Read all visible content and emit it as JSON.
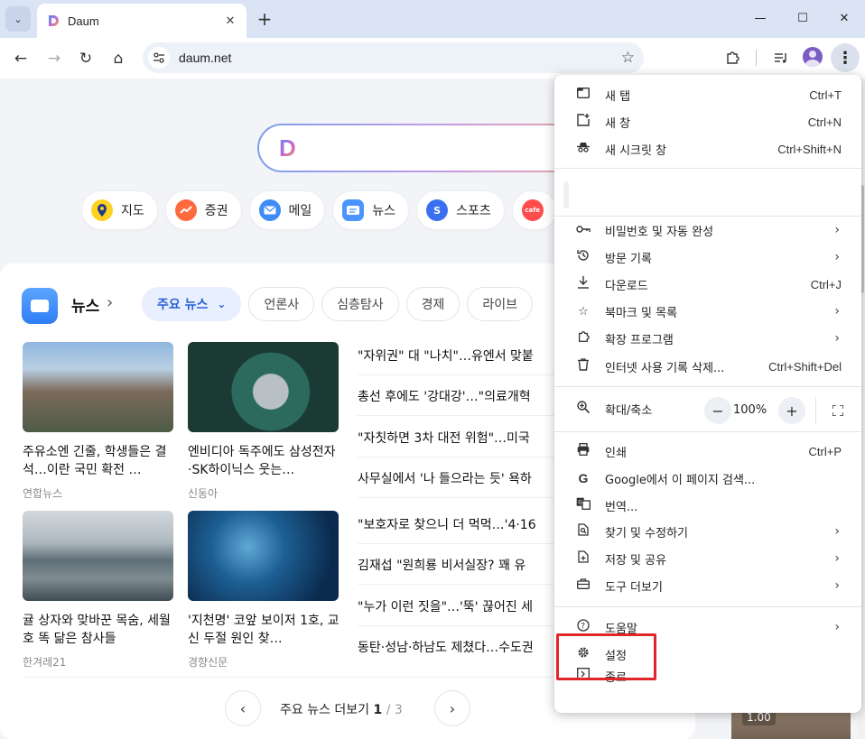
{
  "tab": {
    "title": "Daum",
    "search_tabs_icon": "chevron-down-icon",
    "close_icon": "close-icon",
    "new_tab_icon": "plus-icon"
  },
  "toolbar": {
    "url": "daum.net"
  },
  "page": {
    "quick_links": [
      {
        "label": "지도",
        "icon": "map-pin-icon",
        "color": "#ffd21f"
      },
      {
        "label": "증권",
        "icon": "stock-chart-icon",
        "color": "#ff6a3d"
      },
      {
        "label": "메일",
        "icon": "mail-icon",
        "color": "#3f8cf7"
      },
      {
        "label": "뉴스",
        "icon": "news-icon",
        "color": "#4a94ff"
      },
      {
        "label": "스포츠",
        "icon": "sports-icon",
        "color": "#3a6ff0"
      },
      {
        "label": "cafe",
        "icon": "cafe-icon",
        "color": "#ff4d4d"
      }
    ],
    "news": {
      "heading": "뉴스",
      "chips": [
        "주요 뉴스",
        "언론사",
        "심층탐사",
        "경제",
        "라이브"
      ],
      "cards": [
        {
          "caption": "주유소엔 긴줄, 학생들은 결석…이란 국민 확전 …",
          "source": "연합뉴스"
        },
        {
          "caption": "엔비디아 독주에도 삼성전자·SK하이닉스 웃는…",
          "source": "신동아"
        },
        {
          "caption": "귤 상자와 맞바꾼 목숨, 세월호 똑 닮은 참사들",
          "source": "한겨레21"
        },
        {
          "caption": "'지천명' 코앞 보이저 1호, 교신 두절 원인 찾…",
          "source": "경향신문"
        }
      ],
      "headlines": [
        "\"자위권\" 대 \"나치\"…유엔서 맞붙",
        "총선 후에도 '강대강'…\"의료개혁",
        "\"자칫하면 3차 대전 위험\"…미국",
        "사무실에서 '나 들으라는 듯' 욕하",
        "\"보호자로 찾으니 더 먹먹…'4·16",
        "김재섭 \"원희룡 비서실장? 꽤 유",
        "\"누가 이런 짓을\"…'뚝' 끊어진 세",
        "동탄·성남·하남도 제쳤다…수도권"
      ],
      "pager": {
        "label": "주요 뉴스 더보기",
        "current": "1",
        "total": "/ 3"
      }
    },
    "side_badge": "1.00"
  },
  "menu": {
    "group1": [
      {
        "label": "새 탭",
        "shortcut": "Ctrl+T",
        "icon": "new-tab-icon"
      },
      {
        "label": "새 창",
        "shortcut": "Ctrl+N",
        "icon": "new-window-icon"
      },
      {
        "label": "새 시크릿 창",
        "shortcut": "Ctrl+Shift+N",
        "icon": "incognito-icon"
      }
    ],
    "group2": [
      {
        "label": "비밀번호 및 자동 완성",
        "icon": "key-icon",
        "submenu": true
      },
      {
        "label": "방문 기록",
        "icon": "history-icon",
        "submenu": true
      },
      {
        "label": "다운로드",
        "shortcut": "Ctrl+J",
        "icon": "download-icon"
      },
      {
        "label": "북마크 및 목록",
        "icon": "bookmark-star-icon",
        "submenu": true
      },
      {
        "label": "확장 프로그램",
        "icon": "extension-icon",
        "submenu": true
      },
      {
        "label": "인터넷 사용 기록 삭제...",
        "shortcut": "Ctrl+Shift+Del",
        "icon": "trash-icon"
      }
    ],
    "zoom": {
      "label": "확대/축소",
      "value": "100%",
      "minus": "−",
      "plus": "+"
    },
    "group3": [
      {
        "label": "인쇄",
        "shortcut": "Ctrl+P",
        "icon": "print-icon"
      },
      {
        "label": "Google에서 이 페이지 검색...",
        "icon": "google-icon"
      },
      {
        "label": "번역...",
        "icon": "translate-icon"
      },
      {
        "label": "찾기 및 수정하기",
        "icon": "find-icon",
        "submenu": true
      },
      {
        "label": "저장 및 공유",
        "icon": "save-share-icon",
        "submenu": true
      },
      {
        "label": "도구 더보기",
        "icon": "toolbox-icon",
        "submenu": true
      }
    ],
    "group4": [
      {
        "label": "도움말",
        "icon": "help-icon",
        "submenu": true
      },
      {
        "label": "설정",
        "icon": "settings-gear-icon"
      },
      {
        "label": "종료",
        "icon": "exit-icon"
      }
    ],
    "highlight_color": "#e0252b"
  }
}
